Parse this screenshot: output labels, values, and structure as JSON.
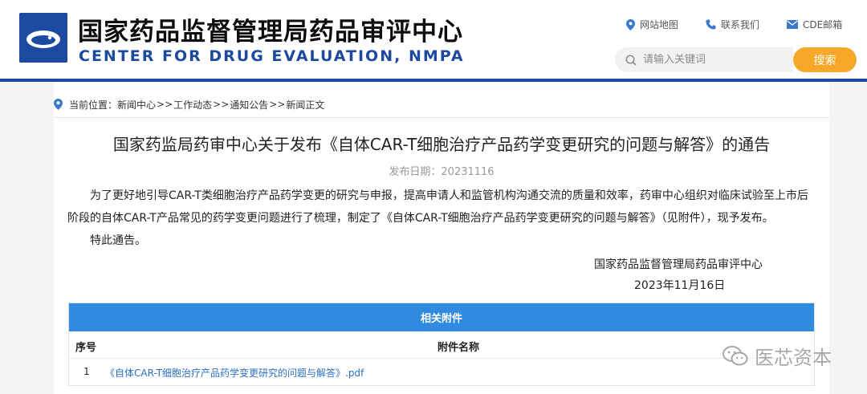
{
  "header": {
    "title_cn": "国家药品监督管理局药品审评中心",
    "title_en": "CENTER FOR DRUG EVALUATION, NMPA",
    "links": [
      {
        "label": "网站地图",
        "icon": "location-pin-icon"
      },
      {
        "label": "联系我们",
        "icon": "phone-icon"
      },
      {
        "label": "CDE邮箱",
        "icon": "mail-icon"
      }
    ],
    "search": {
      "placeholder": "请输入关键词",
      "button_label": "搜索"
    }
  },
  "breadcrumb": {
    "prefix": "当前位置：",
    "items": [
      "新闻中心",
      "工作动态",
      "通知公告",
      "新闻正文"
    ],
    "separator": ">>"
  },
  "article": {
    "title": "国家药监局药审中心关于发布《自体CAR-T细胞治疗产品药学变更研究的问题与解答》的通告",
    "publish_date": "发布日期：20231116",
    "paragraph1_line1": "为了更好地引导CAR-T类细胞治疗产品药学变更的研究与申报，提高申请人和监管机构沟通交流的质量和效率，药审中心组织对临床试验至上市后",
    "paragraph1_line2": "阶段的自体CAR-T产品常见的药学变更问题进行了梳理，制定了《自体CAR-T细胞治疗产品药学变更研究的问题与解答》（见附件），现予发布。",
    "paragraph2": "特此通告。",
    "signature_org": "国家药品监督管理局药品审评中心",
    "signature_date": "2023年11月16日"
  },
  "attachments": {
    "header": "相关附件",
    "col_no": "序号",
    "col_name": "附件名称",
    "rows": [
      {
        "no": "1",
        "name": "《自体CAR-T细胞治疗产品药学变更研究的问题与解答》.pdf"
      }
    ]
  },
  "watermark": {
    "text": "医芯资本",
    "icon": "wechat-icon"
  },
  "colors": {
    "brand_blue": "#1b4aa0",
    "search_button": "#f8a829",
    "attachment_header": "#2f8ae0",
    "link": "#2b6fc2"
  }
}
